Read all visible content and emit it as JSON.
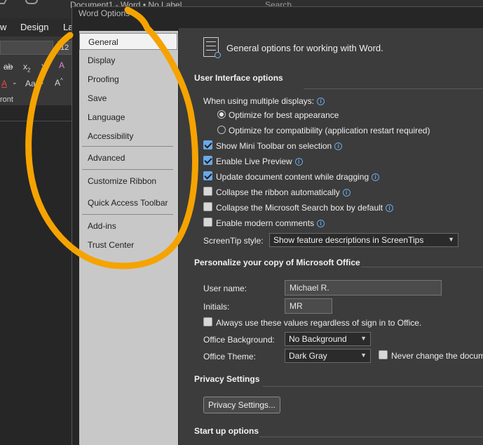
{
  "background": {
    "doc_title": "Document1  -  Word  •  No Label",
    "search_text": "Search",
    "menu": [
      "w",
      "Design",
      "La"
    ],
    "font_size": "12",
    "font_label": "ront"
  },
  "dialog": {
    "title": "Word Options"
  },
  "nav": {
    "items": [
      {
        "label": "General"
      },
      {
        "label": "Display"
      },
      {
        "label": "Proofing"
      },
      {
        "label": "Save"
      },
      {
        "label": "Language"
      },
      {
        "label": "Accessibility"
      },
      {
        "label": "Advanced"
      },
      {
        "label": "Customize Ribbon"
      },
      {
        "label": "Quick Access Toolbar"
      },
      {
        "label": "Add-ins"
      },
      {
        "label": "Trust Center"
      }
    ]
  },
  "content": {
    "header": "General options for working with Word.",
    "ui_options": {
      "title": "User Interface options",
      "multi_display_label": "When using multiple displays:",
      "radio_best": "Optimize for best appearance",
      "radio_compat": "Optimize for compatibility (application restart required)",
      "mini_toolbar": "Show Mini Toolbar on selection",
      "live_preview": "Enable Live Preview",
      "update_drag": "Update document content while dragging",
      "collapse_ribbon": "Collapse the ribbon automatically",
      "collapse_search": "Collapse the Microsoft Search box by default",
      "modern_comments": "Enable modern comments",
      "screentip_label": "ScreenTip style:",
      "screentip_value": "Show feature descriptions in ScreenTips"
    },
    "personalize": {
      "title": "Personalize your copy of Microsoft Office",
      "user_name_label": "User name:",
      "user_name_value": "Michael R.",
      "initials_label": "Initials:",
      "initials_value": "MR",
      "always_use": "Always use these values regardless of sign in to Office.",
      "background_label": "Office Background:",
      "background_value": "No Background",
      "theme_label": "Office Theme:",
      "theme_value": "Dark Gray",
      "never_change": "Never change the docum"
    },
    "privacy": {
      "title": "Privacy Settings",
      "button": "Privacy Settings..."
    },
    "startup": {
      "title": "Start up options"
    }
  },
  "colors": {
    "annotation": "#f5a300",
    "accent": "#6aa9e9"
  }
}
